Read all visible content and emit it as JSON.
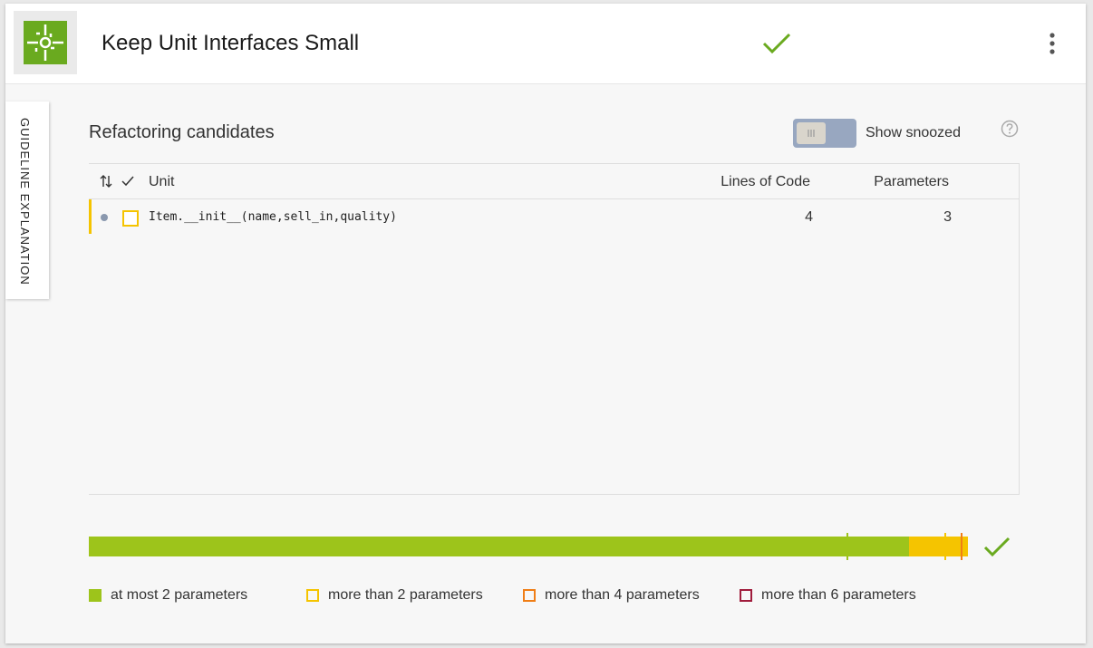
{
  "header": {
    "title": "Keep Unit Interfaces Small",
    "logo_icon": "puzzle-icon",
    "status_icon": "check-icon",
    "menu_icon": "more-vert-icon"
  },
  "side_tab": {
    "label": "GUIDELINE EXPLANATION"
  },
  "section": {
    "title": "Refactoring candidates",
    "toggle_label": "Show snoozed",
    "toggle_on": false,
    "help_icon": "help-icon"
  },
  "table": {
    "columns": {
      "unit": "Unit",
      "lines_of_code": "Lines of Code",
      "parameters": "Parameters"
    },
    "rows": [
      {
        "unit": "Item.__init__(name,sell_in,quality)",
        "lines_of_code": "4",
        "parameters": "3"
      }
    ]
  },
  "risk_bar": {
    "segments": [
      {
        "label": "at most 2 parameters",
        "fraction": 0.933
      },
      {
        "label": "more than 2 parameters",
        "fraction": 0.067
      },
      {
        "label": "more than 4 parameters",
        "fraction": 0.0
      },
      {
        "label": "more than 6 parameters",
        "fraction": 0.0
      }
    ]
  },
  "legend": [
    {
      "label": "at most 2 parameters",
      "color": "#9dc41b",
      "filled": true
    },
    {
      "label": "more than 2 parameters",
      "color": "#f5c400",
      "filled": false
    },
    {
      "label": "more than 4 parameters",
      "color": "#f07e16",
      "filled": false
    },
    {
      "label": "more than 6 parameters",
      "color": "#a01c3c",
      "filled": false
    }
  ],
  "colors": {
    "low": "#9dc41b",
    "moderate": "#f5c400",
    "high": "#f07e16",
    "very_high": "#a01c3c",
    "accent_check": "#6aaa1f"
  }
}
